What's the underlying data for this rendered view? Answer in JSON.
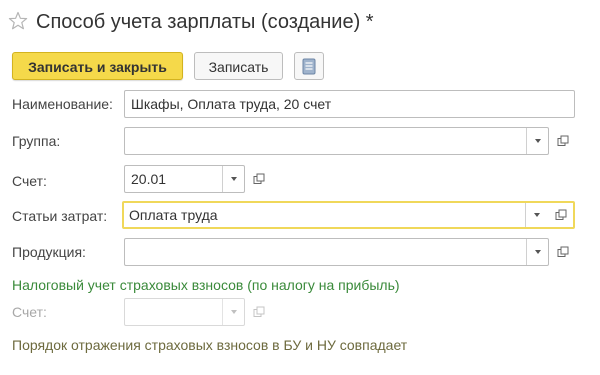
{
  "window": {
    "title": "Способ учета зарплаты (создание) *"
  },
  "toolbar": {
    "save_close_label": "Записать и закрыть",
    "save_label": "Записать"
  },
  "form": {
    "name": {
      "label": "Наименование:",
      "value": "Шкафы, Оплата труда, 20 счет"
    },
    "group": {
      "label": "Группа:",
      "value": ""
    },
    "account": {
      "label": "Счет:",
      "value": "20.01"
    },
    "cost_item": {
      "label": "Статьи затрат:",
      "value": "Оплата труда"
    },
    "product": {
      "label": "Продукция:",
      "value": ""
    },
    "tax_section_title": "Налоговый учет страховых взносов (по налогу на прибыль)",
    "tax_account": {
      "label": "Счет:",
      "value": ""
    },
    "note": "Порядок отражения страховых взносов в БУ и НУ совпадает"
  },
  "colors": {
    "primary_button": "#f5d94a",
    "focus_border": "#f0d85a",
    "section_title": "#3a8a3a",
    "note_text": "#6d6a3e"
  }
}
